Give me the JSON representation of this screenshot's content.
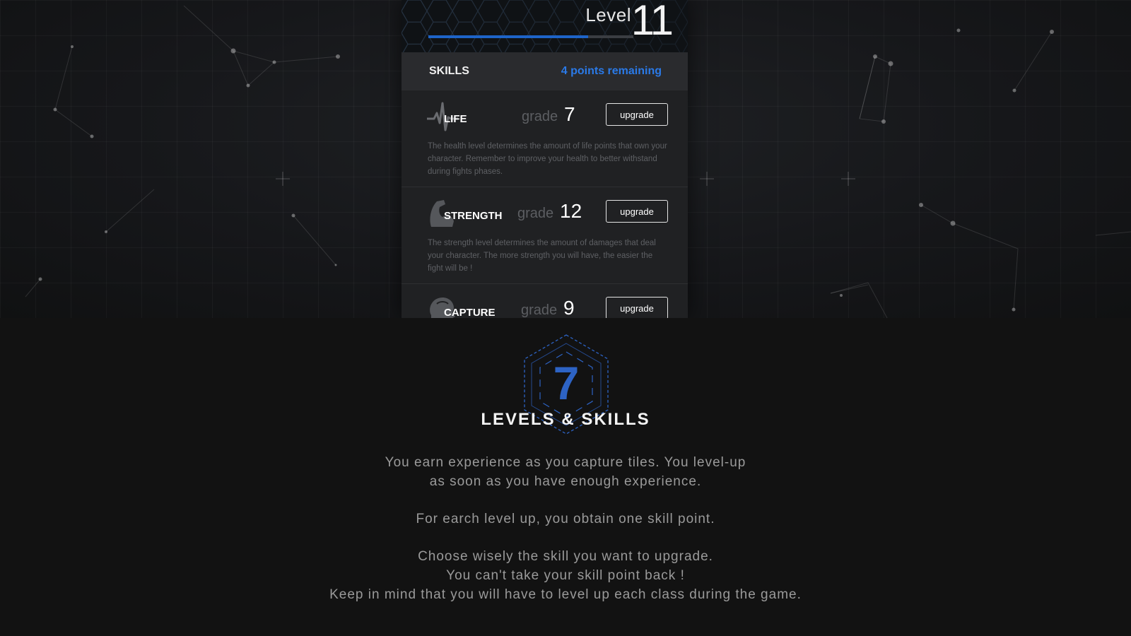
{
  "header": {
    "level_label": "Level",
    "level_number": "11",
    "xp_progress_fraction": 0.78
  },
  "skills_bar": {
    "title": "SKILLS",
    "points_remaining": "4 points remaining"
  },
  "skills": [
    {
      "name": "LIFE",
      "icon": "heartbeat-icon",
      "grade_label": "grade",
      "grade": "7",
      "button": "upgrade",
      "description": "The health level determines the amount of life points that own your character. Remember to improve your health to better withstand during fights phases."
    },
    {
      "name": "STRENGTH",
      "icon": "flexed-arm-icon",
      "grade_label": "grade",
      "grade": "12",
      "button": "upgrade",
      "description": "The strength level determines the amount of damages that deal your character. The more strength you will have, the easier the fight will be !"
    },
    {
      "name": "CAPTURE",
      "icon": "head-icon",
      "grade_label": "grade",
      "grade": "9",
      "button": "upgrade",
      "description": ""
    }
  ],
  "section": {
    "badge_number": "7",
    "title": "LEVELS & SKILLS",
    "paragraphs": [
      [
        "You earn experience as you capture tiles. You level-up",
        "as soon as you have enough experience."
      ],
      [
        "For earch level up, you obtain one skill point."
      ],
      [
        "Choose wisely the skill you want to upgrade.",
        "You can't take your skill point back !",
        "Keep in mind that you will have to level up each class during the game."
      ]
    ]
  },
  "colors": {
    "accent_blue": "#2a7ae8",
    "badge_blue": "#2d63c4",
    "background": "#121212"
  }
}
